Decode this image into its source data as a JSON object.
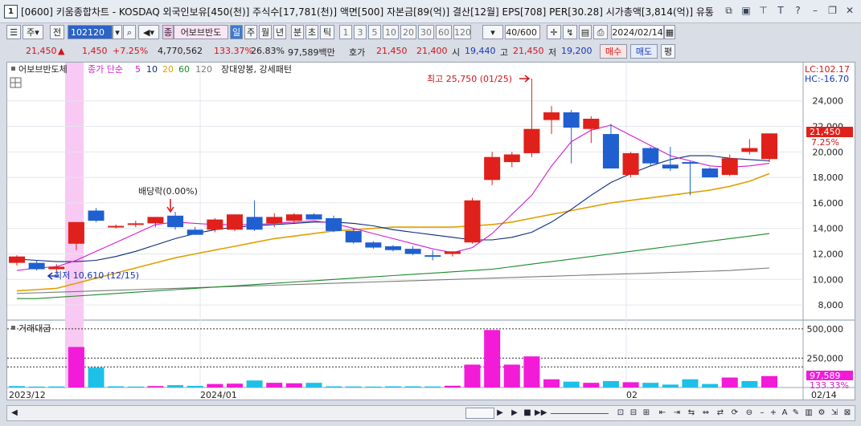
{
  "window": {
    "screen_no": "1",
    "title": "[0600] 키움종합차트 - KOSDAQ 외국인보유[450(천)] 주식수[17,781(천)] 액면[500] 자본금[89(억)] 결산[12월] EPS[708] PER[30.28] 시가총액[3,814(억)] 유통"
  },
  "toolbar": {
    "period_main": "주",
    "whole": "전",
    "code": "102120",
    "stock_name": "어보브반도",
    "stock_badge": "종",
    "periods": [
      "일",
      "주",
      "월",
      "년",
      "분",
      "초",
      "틱"
    ],
    "active_period": "일",
    "intervals": [
      "1",
      "3",
      "5",
      "10",
      "20",
      "30",
      "60",
      "120"
    ],
    "count": "40/600",
    "date": "2024/02/14"
  },
  "pricebar": {
    "price": "21,450",
    "change": "1,450",
    "change_pct": "+7.25%",
    "volume": "4,770,562",
    "vol_ratio": "133.37%",
    "turnover": "26.83%",
    "amount": "97,589백만",
    "hoga_label": "호가",
    "ask": "21,450",
    "bid": "21,400",
    "open_label": "시",
    "open": "19,440",
    "high_label": "고",
    "high": "21,450",
    "low_label": "저",
    "low": "19,200",
    "buy_btn": "매수",
    "sell_btn": "매도",
    "eval_btn": "평"
  },
  "price_panel": {
    "stock_tag": "어보브반도체",
    "ma_legend_prefix": "종가 단순",
    "ma_legend": [
      {
        "period": "5",
        "color": "#d21bd2"
      },
      {
        "period": "10",
        "color": "#0a2a7a"
      },
      {
        "period": "20",
        "color": "#e0a000"
      },
      {
        "period": "60",
        "color": "#1a8a2a"
      },
      {
        "period": "120",
        "color": "#7a7a7a"
      }
    ],
    "pattern_label": "장대양봉, 강세패턴",
    "lc_label": "LC:102.17",
    "hc_label": "HC:-16.70",
    "high_annotation": "최고 25,750 (01/25)",
    "low_annotation": "최저 10,610 (12/15)",
    "dividend_annotation": "배당락(0.00%)",
    "current_price_tag": "21,450",
    "current_pct_tag": "7.25%"
  },
  "volume_panel": {
    "title": "거래대금",
    "current_tag": "97,589",
    "ratio_tag": "133.33%"
  },
  "x_axis_labels": [
    "2023/12",
    "2024/01",
    "02",
    "02/14"
  ],
  "chart_data": {
    "type": "candlestick",
    "y_ticks": [
      8000,
      10000,
      12000,
      14000,
      16000,
      18000,
      20000,
      22000,
      24000
    ],
    "y_range": [
      7000,
      26500
    ],
    "candles": [
      {
        "o": 11300,
        "h": 11900,
        "l": 11100,
        "c": 11800
      },
      {
        "o": 11300,
        "h": 11500,
        "l": 10700,
        "c": 10800
      },
      {
        "o": 10800,
        "h": 11200,
        "l": 10610,
        "c": 11000
      },
      {
        "o": 12800,
        "h": 14300,
        "l": 12300,
        "c": 14500
      },
      {
        "o": 15400,
        "h": 15600,
        "l": 14500,
        "c": 14600
      },
      {
        "o": 14200,
        "h": 14300,
        "l": 14000,
        "c": 14200
      },
      {
        "o": 14300,
        "h": 14600,
        "l": 14100,
        "c": 14400
      },
      {
        "o": 14400,
        "h": 14900,
        "l": 14100,
        "c": 14900
      },
      {
        "o": 15000,
        "h": 15300,
        "l": 13900,
        "c": 14100
      },
      {
        "o": 13900,
        "h": 14100,
        "l": 13500,
        "c": 13500
      },
      {
        "o": 13900,
        "h": 14800,
        "l": 13700,
        "c": 14700
      },
      {
        "o": 13900,
        "h": 15100,
        "l": 13800,
        "c": 15100
      },
      {
        "o": 14900,
        "h": 16200,
        "l": 13800,
        "c": 13900
      },
      {
        "o": 14400,
        "h": 15200,
        "l": 14100,
        "c": 14900
      },
      {
        "o": 14600,
        "h": 15200,
        "l": 14400,
        "c": 15100
      },
      {
        "o": 15100,
        "h": 15200,
        "l": 14700,
        "c": 14700
      },
      {
        "o": 14800,
        "h": 15000,
        "l": 13700,
        "c": 13800
      },
      {
        "o": 13800,
        "h": 14000,
        "l": 12800,
        "c": 12900
      },
      {
        "o": 12900,
        "h": 13000,
        "l": 12400,
        "c": 12500
      },
      {
        "o": 12600,
        "h": 12700,
        "l": 12200,
        "c": 12300
      },
      {
        "o": 12400,
        "h": 12600,
        "l": 11900,
        "c": 12000
      },
      {
        "o": 11900,
        "h": 12300,
        "l": 11500,
        "c": 11800
      },
      {
        "o": 12000,
        "h": 12200,
        "l": 11800,
        "c": 12200
      },
      {
        "o": 12900,
        "h": 16400,
        "l": 12800,
        "c": 16200
      },
      {
        "o": 17800,
        "h": 20000,
        "l": 17400,
        "c": 19600
      },
      {
        "o": 19200,
        "h": 20000,
        "l": 18800,
        "c": 19800
      },
      {
        "o": 19900,
        "h": 25750,
        "l": 19600,
        "c": 21800
      },
      {
        "o": 22500,
        "h": 23600,
        "l": 21400,
        "c": 23100
      },
      {
        "o": 23100,
        "h": 23300,
        "l": 19100,
        "c": 21900
      },
      {
        "o": 21800,
        "h": 22800,
        "l": 20700,
        "c": 22600
      },
      {
        "o": 21400,
        "h": 22200,
        "l": 18700,
        "c": 18700
      },
      {
        "o": 18200,
        "h": 20000,
        "l": 18000,
        "c": 19900
      },
      {
        "o": 20300,
        "h": 20400,
        "l": 18900,
        "c": 19100
      },
      {
        "o": 19000,
        "h": 20400,
        "l": 18500,
        "c": 18700
      },
      {
        "o": 19200,
        "h": 19300,
        "l": 16600,
        "c": 19100
      },
      {
        "o": 18700,
        "h": 18800,
        "l": 18000,
        "c": 18000
      },
      {
        "o": 18200,
        "h": 19800,
        "l": 18100,
        "c": 19500
      },
      {
        "o": 20000,
        "h": 21000,
        "l": 19800,
        "c": 20300
      },
      {
        "o": 19440,
        "h": 21450,
        "l": 19200,
        "c": 21450
      }
    ],
    "ma5": [
      10700,
      10900,
      11000,
      11500,
      12200,
      12900,
      13600,
      14300,
      14500,
      14400,
      14300,
      14300,
      14300,
      14400,
      14500,
      14600,
      14400,
      14000,
      13600,
      13200,
      12800,
      12400,
      12100,
      12500,
      13600,
      15100,
      16600,
      18900,
      20800,
      21700,
      22100,
      21300,
      20500,
      19700,
      19300,
      18900,
      18800,
      18900,
      19100
    ],
    "ma10": [
      11600,
      11500,
      11400,
      11400,
      11500,
      11800,
      12200,
      12700,
      13200,
      13600,
      13900,
      14100,
      14200,
      14300,
      14400,
      14500,
      14500,
      14400,
      14200,
      13900,
      13700,
      13500,
      13300,
      13100,
      13100,
      13300,
      13700,
      14500,
      15500,
      16600,
      17600,
      18300,
      18900,
      19400,
      19700,
      19700,
      19500,
      19400,
      19300
    ],
    "ma20": [
      9100,
      9200,
      9300,
      9700,
      10100,
      10500,
      10900,
      11300,
      11700,
      12000,
      12300,
      12600,
      12900,
      13200,
      13400,
      13600,
      13800,
      13900,
      14000,
      14100,
      14100,
      14100,
      14100,
      14200,
      14300,
      14500,
      14800,
      15100,
      15400,
      15700,
      16000,
      16200,
      16400,
      16600,
      16800,
      17000,
      17300,
      17700,
      18300
    ],
    "ma60": [
      8500,
      8500,
      8600,
      8700,
      8800,
      8900,
      9000,
      9100,
      9200,
      9300,
      9400,
      9500,
      9600,
      9700,
      9800,
      9900,
      10000,
      10100,
      10200,
      10300,
      10400,
      10500,
      10600,
      10700,
      10800,
      11000,
      11200,
      11400,
      11600,
      11800,
      12000,
      12200,
      12400,
      12600,
      12800,
      13000,
      13200,
      13400,
      13600
    ],
    "ma120": [
      8900,
      8950,
      9000,
      9050,
      9100,
      9150,
      9200,
      9250,
      9300,
      9350,
      9400,
      9450,
      9500,
      9550,
      9600,
      9650,
      9700,
      9750,
      9800,
      9850,
      9900,
      9950,
      10000,
      10050,
      10100,
      10150,
      10200,
      10250,
      10300,
      10350,
      10400,
      10450,
      10500,
      10550,
      10600,
      10650,
      10700,
      10800,
      10900
    ],
    "volume_ticks": [
      250000,
      500000
    ],
    "volume_range": [
      0,
      540000
    ],
    "volume": [
      12000,
      8000,
      9000,
      345000,
      170000,
      10000,
      8000,
      12000,
      20000,
      14000,
      30000,
      33000,
      60000,
      40000,
      36000,
      40000,
      10000,
      9000,
      8000,
      10000,
      10000,
      9000,
      15000,
      195000,
      490000,
      195000,
      265000,
      70000,
      50000,
      40000,
      55000,
      45000,
      40000,
      25000,
      70000,
      30000,
      85000,
      55000,
      97589
    ],
    "volume_up": [
      false,
      false,
      false,
      true,
      false,
      false,
      false,
      true,
      false,
      false,
      true,
      true,
      false,
      true,
      true,
      false,
      false,
      false,
      false,
      false,
      false,
      false,
      true,
      true,
      true,
      true,
      true,
      true,
      false,
      true,
      false,
      true,
      false,
      false,
      false,
      false,
      true,
      false,
      true
    ]
  }
}
